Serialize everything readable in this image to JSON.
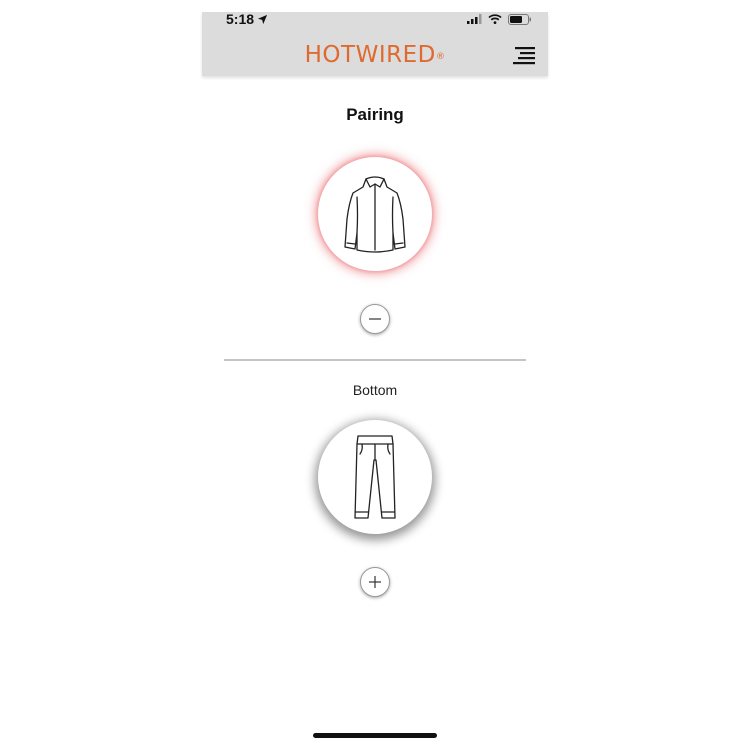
{
  "status_bar": {
    "time": "5:18",
    "location_icon": "location-arrow-icon",
    "signal_icon": "cellular-signal-icon",
    "wifi_icon": "wifi-icon",
    "battery_icon": "battery-icon"
  },
  "header": {
    "brand": "HOTWIRED",
    "brand_mark": "®",
    "menu_icon": "menu-icon"
  },
  "page": {
    "title": "Pairing"
  },
  "top_section": {
    "garment_icon": "shirt-icon",
    "action_icon": "minus-icon"
  },
  "bottom_section": {
    "label": "Bottom",
    "garment_icon": "pants-icon",
    "action_icon": "plus-icon"
  },
  "colors": {
    "brand": "#e0692f",
    "header_bg": "#dcdcdc",
    "selected_glow": "#e85a5f",
    "divider": "#c4c4c4"
  }
}
